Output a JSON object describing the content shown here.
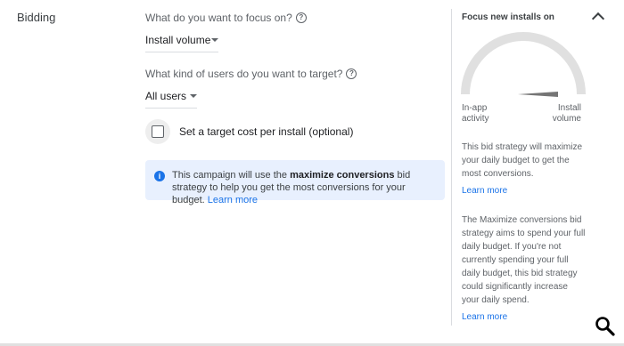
{
  "section": {
    "title": "Bidding"
  },
  "focus": {
    "question": "What do you want to focus on?",
    "selected": "Install volume"
  },
  "users": {
    "question": "What kind of users do you want to target?",
    "selected": "All users"
  },
  "target_cost": {
    "label": "Set a target cost per install (optional)",
    "checked": false
  },
  "info": {
    "text_before": "This campaign will use the ",
    "bold": "maximize conversions",
    "text_after": " bid strategy to help you get the most conversions for your budget.",
    "link": "Learn more"
  },
  "sidebar": {
    "title": "Focus new installs on",
    "gauge": {
      "left_label": "In-app activity",
      "right_label": "Install volume",
      "level": 1.0
    },
    "para1": "This bid strategy will maximize your daily budget to get the most conversions.",
    "link1": "Learn more",
    "para2": "The Maximize conversions bid strategy aims to spend your full daily budget. If you're not currently spending your full daily budget, this bid strategy could significantly increase your daily spend.",
    "link2": "Learn more"
  },
  "colors": {
    "accent": "#1a73e8",
    "info_bg": "#e8f0fe"
  }
}
